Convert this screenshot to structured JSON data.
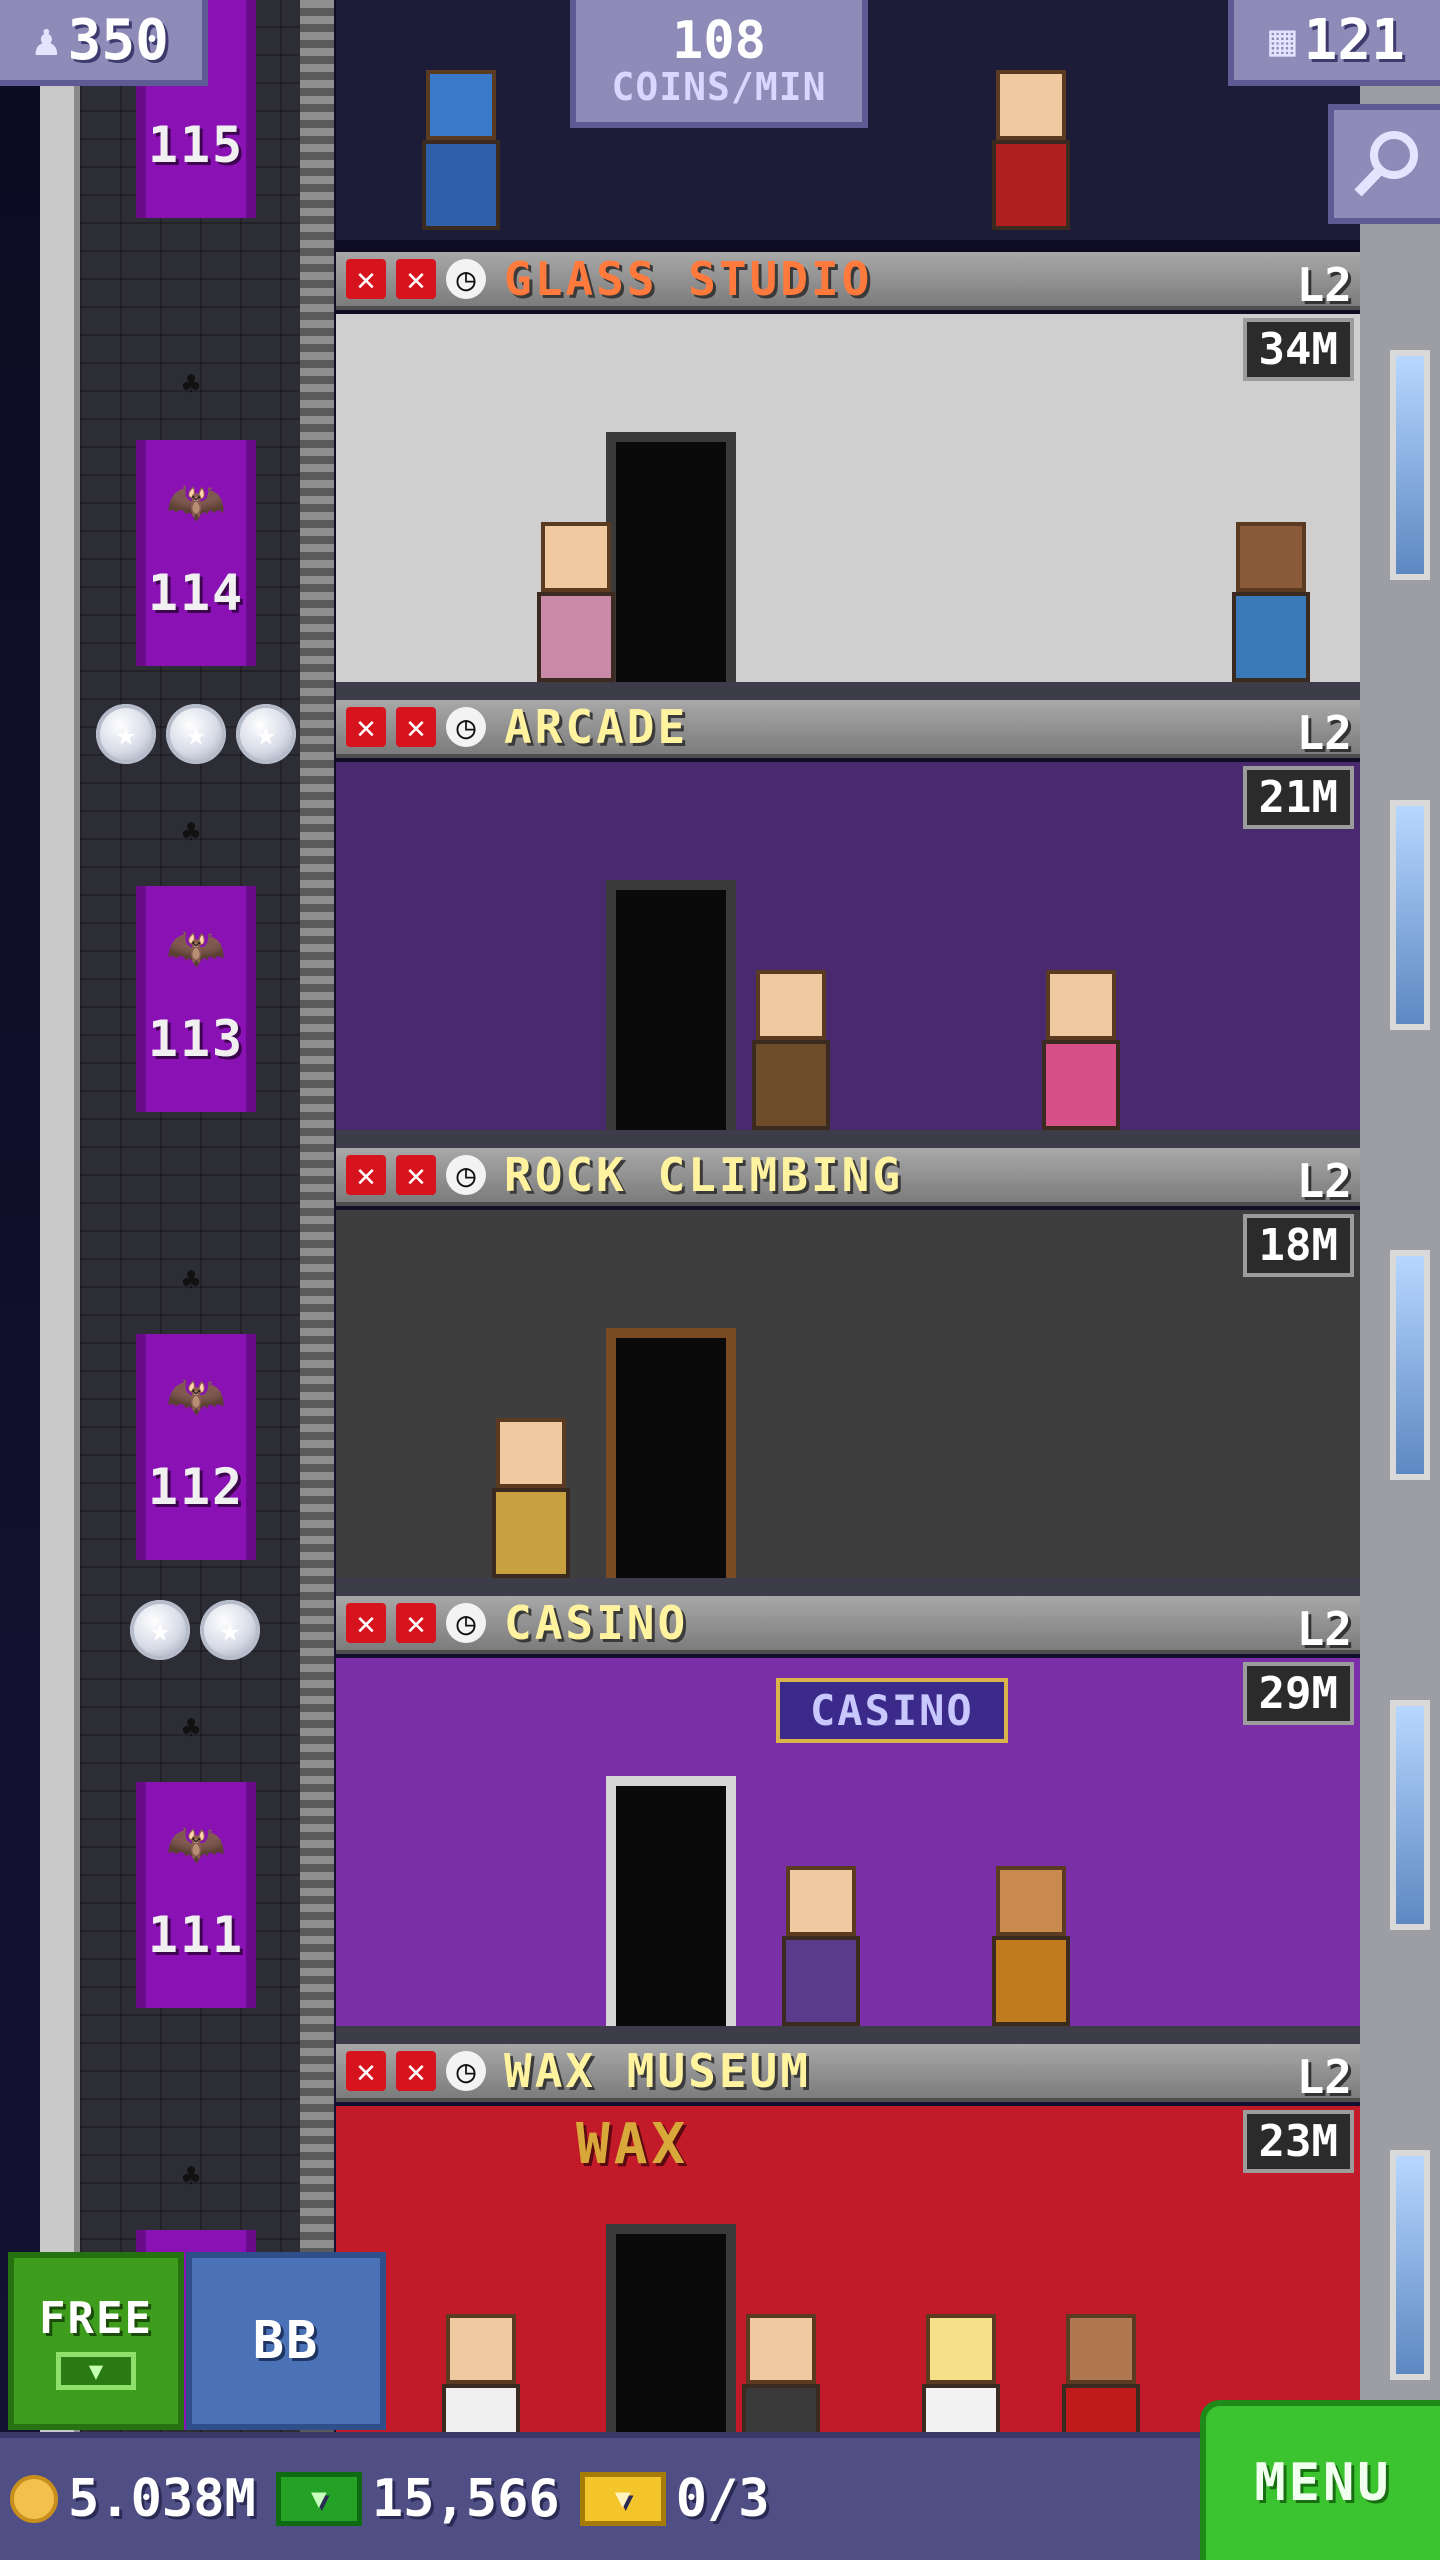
{
  "top_bar": {
    "population": {
      "icon": "person-icon",
      "value": "350"
    },
    "coins_rate": {
      "value": "108",
      "label": "COINS/MIN"
    },
    "floors": {
      "icon": "building-icon",
      "value": "121"
    }
  },
  "elevator": {
    "doors": [
      {
        "floor": "115"
      },
      {
        "floor": "114"
      },
      {
        "floor": "113"
      },
      {
        "floor": "112"
      },
      {
        "floor": "111"
      }
    ],
    "stars": [
      {
        "count": 3
      },
      {
        "count": 2
      }
    ]
  },
  "floors": [
    {
      "name": "GLASS STUDIO",
      "level": "L2",
      "stock": "34M",
      "name_color": "#ff7a3c",
      "room_color": "#cfcfcf"
    },
    {
      "name": "ARCADE",
      "level": "L2",
      "stock": "21M",
      "name_color": "#fff3a0",
      "room_color": "#4a2a6e"
    },
    {
      "name": "ROCK CLIMBING",
      "level": "L2",
      "stock": "18M",
      "name_color": "#fff3a0",
      "room_color": "#3e3e3e"
    },
    {
      "name": "CASINO",
      "level": "L2",
      "stock": "29M",
      "name_color": "#fff3a0",
      "room_color": "#7a2fa8",
      "sign": "CASINO"
    },
    {
      "name": "WAX MUSEUM",
      "level": "L2",
      "stock": "23M",
      "name_color": "#fff3a0",
      "room_color": "#c21a28",
      "sign": "WAX"
    }
  ],
  "buttons": {
    "free": "FREE",
    "bb": "BB",
    "menu": "MENU"
  },
  "bottom_bar": {
    "coins": "5.038M",
    "bux": "15,566",
    "tickets": "0/3"
  }
}
